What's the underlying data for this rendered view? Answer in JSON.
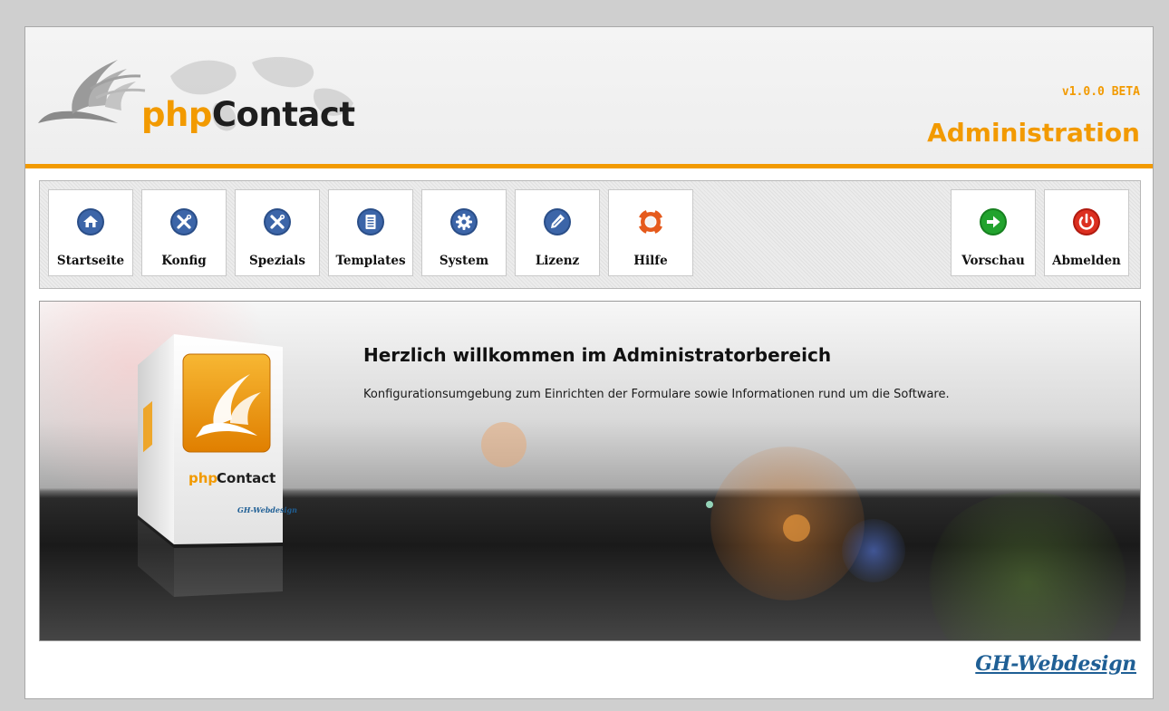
{
  "header": {
    "logo_php": "php",
    "logo_contact": "Contact",
    "version": "v1.0.0 BETA",
    "section_title": "Administration"
  },
  "nav": {
    "items": [
      {
        "label": "Startseite",
        "icon": "home-icon"
      },
      {
        "label": "Konfig",
        "icon": "tools-icon"
      },
      {
        "label": "Spezials",
        "icon": "tools-icon"
      },
      {
        "label": "Templates",
        "icon": "document-icon"
      },
      {
        "label": "System",
        "icon": "gear-icon"
      },
      {
        "label": "Lizenz",
        "icon": "pen-icon"
      },
      {
        "label": "Hilfe",
        "icon": "lifebuoy-icon"
      }
    ],
    "actions": [
      {
        "label": "Vorschau",
        "icon": "arrow-right-icon"
      },
      {
        "label": "Abmelden",
        "icon": "power-icon"
      }
    ]
  },
  "banner": {
    "title": "Herzlich willkommen im Administratorbereich",
    "text": "Konfigurationsumgebung zum Einrichten der Formulare sowie Informationen rund um die Software.",
    "box_brand": "phpContact",
    "box_maker": "GH-Webdesign"
  },
  "footer": {
    "brand": "GH-Webdesign"
  },
  "colors": {
    "accent": "#f29a00",
    "icon_blue": "#2a4e88",
    "preview_green": "#1a9a2a",
    "logout_red": "#d4261a",
    "brand_blue": "#1f5f95"
  }
}
